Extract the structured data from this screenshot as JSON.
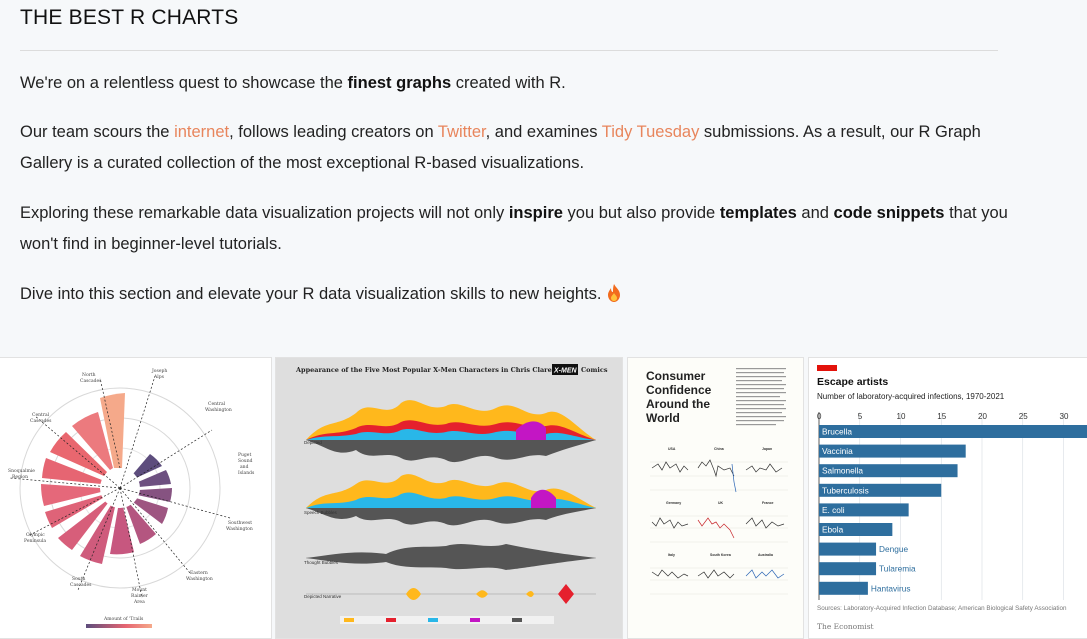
{
  "header": {
    "title": "THE BEST R CHARTS"
  },
  "intro": {
    "p1_a": "We're on a relentless quest to showcase the ",
    "p1_b": "finest graphs",
    "p1_c": " created with R.",
    "p2_a": "Our team scours the ",
    "p2_link1": "internet",
    "p2_b": ", follows leading creators on ",
    "p2_link2": "Twitter",
    "p2_c": ", and examines ",
    "p2_link3": "Tidy Tuesday",
    "p2_d": " submissions. As a result, our R Graph Gallery is a curated collection of the most exceptional R-based visualizations.",
    "p3_a": "Exploring these remarkable data visualization projects will not only ",
    "p3_b": "inspire",
    "p3_c": " you but also provide ",
    "p3_d": "templates",
    "p3_e": " and ",
    "p3_f": "code snippets",
    "p3_g": " that you won't find in beginner-level tutorials.",
    "p4": "Dive into this section and elevate your R data visualization skills to new heights."
  },
  "accent_color": "#e8855c",
  "gallery": {
    "card1": {
      "legend_title": "Amount of 'Trails"
    },
    "card2": {
      "title": "Appearance of the Five Most Popular X-Men Characters in Chris Claremont's",
      "title_end": "Comics",
      "logo": "X-MEN",
      "row_labels": [
        "Depicted",
        "Speech Bubbles",
        "Thought Bubbles",
        "Depicted Narrative"
      ]
    },
    "card3": {
      "title_lines": [
        "Consumer",
        "Confidence",
        "Around the",
        "World"
      ],
      "panels": [
        "USA",
        "China",
        "Japan",
        "Germany",
        "UK",
        "France",
        "Italy",
        "South Korea",
        "Australia"
      ]
    },
    "card4": {
      "title": "Escape artists",
      "subtitle": "Number of laboratory-acquired infections, 1970-2021",
      "ticks": [
        "0",
        "5",
        "10",
        "15",
        "20",
        "25",
        "30"
      ],
      "bars": [
        {
          "label": "Brucella",
          "value": 34
        },
        {
          "label": "Vaccinia",
          "value": 18
        },
        {
          "label": "Salmonella",
          "value": 17
        },
        {
          "label": "Tuberculosis",
          "value": 15
        },
        {
          "label": "E. coli",
          "value": 11
        },
        {
          "label": "Ebola",
          "value": 9
        },
        {
          "label": "Dengue",
          "value": 7
        },
        {
          "label": "Tularemia",
          "value": 7
        },
        {
          "label": "Hantavirus",
          "value": 6
        }
      ],
      "source": "Sources: Laboratory-Acquired Infection Database; American Biological Safety Association",
      "brand": "The Economist"
    }
  }
}
